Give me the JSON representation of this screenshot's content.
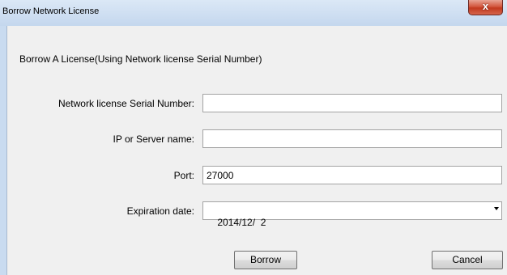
{
  "window": {
    "title": "Borrow Network License",
    "close_glyph": "x"
  },
  "dialog": {
    "heading": "Borrow A License(Using Network license Serial Number)",
    "fields": {
      "serial": {
        "label": "Network license Serial Number:",
        "value": ""
      },
      "server": {
        "label": "IP or Server name:",
        "value": ""
      },
      "port": {
        "label": "Port:",
        "value": "27000"
      },
      "expiration": {
        "label": "Expiration date:",
        "value": "2014/12/  2"
      }
    },
    "buttons": {
      "borrow": "Borrow",
      "cancel": "Cancel"
    }
  }
}
